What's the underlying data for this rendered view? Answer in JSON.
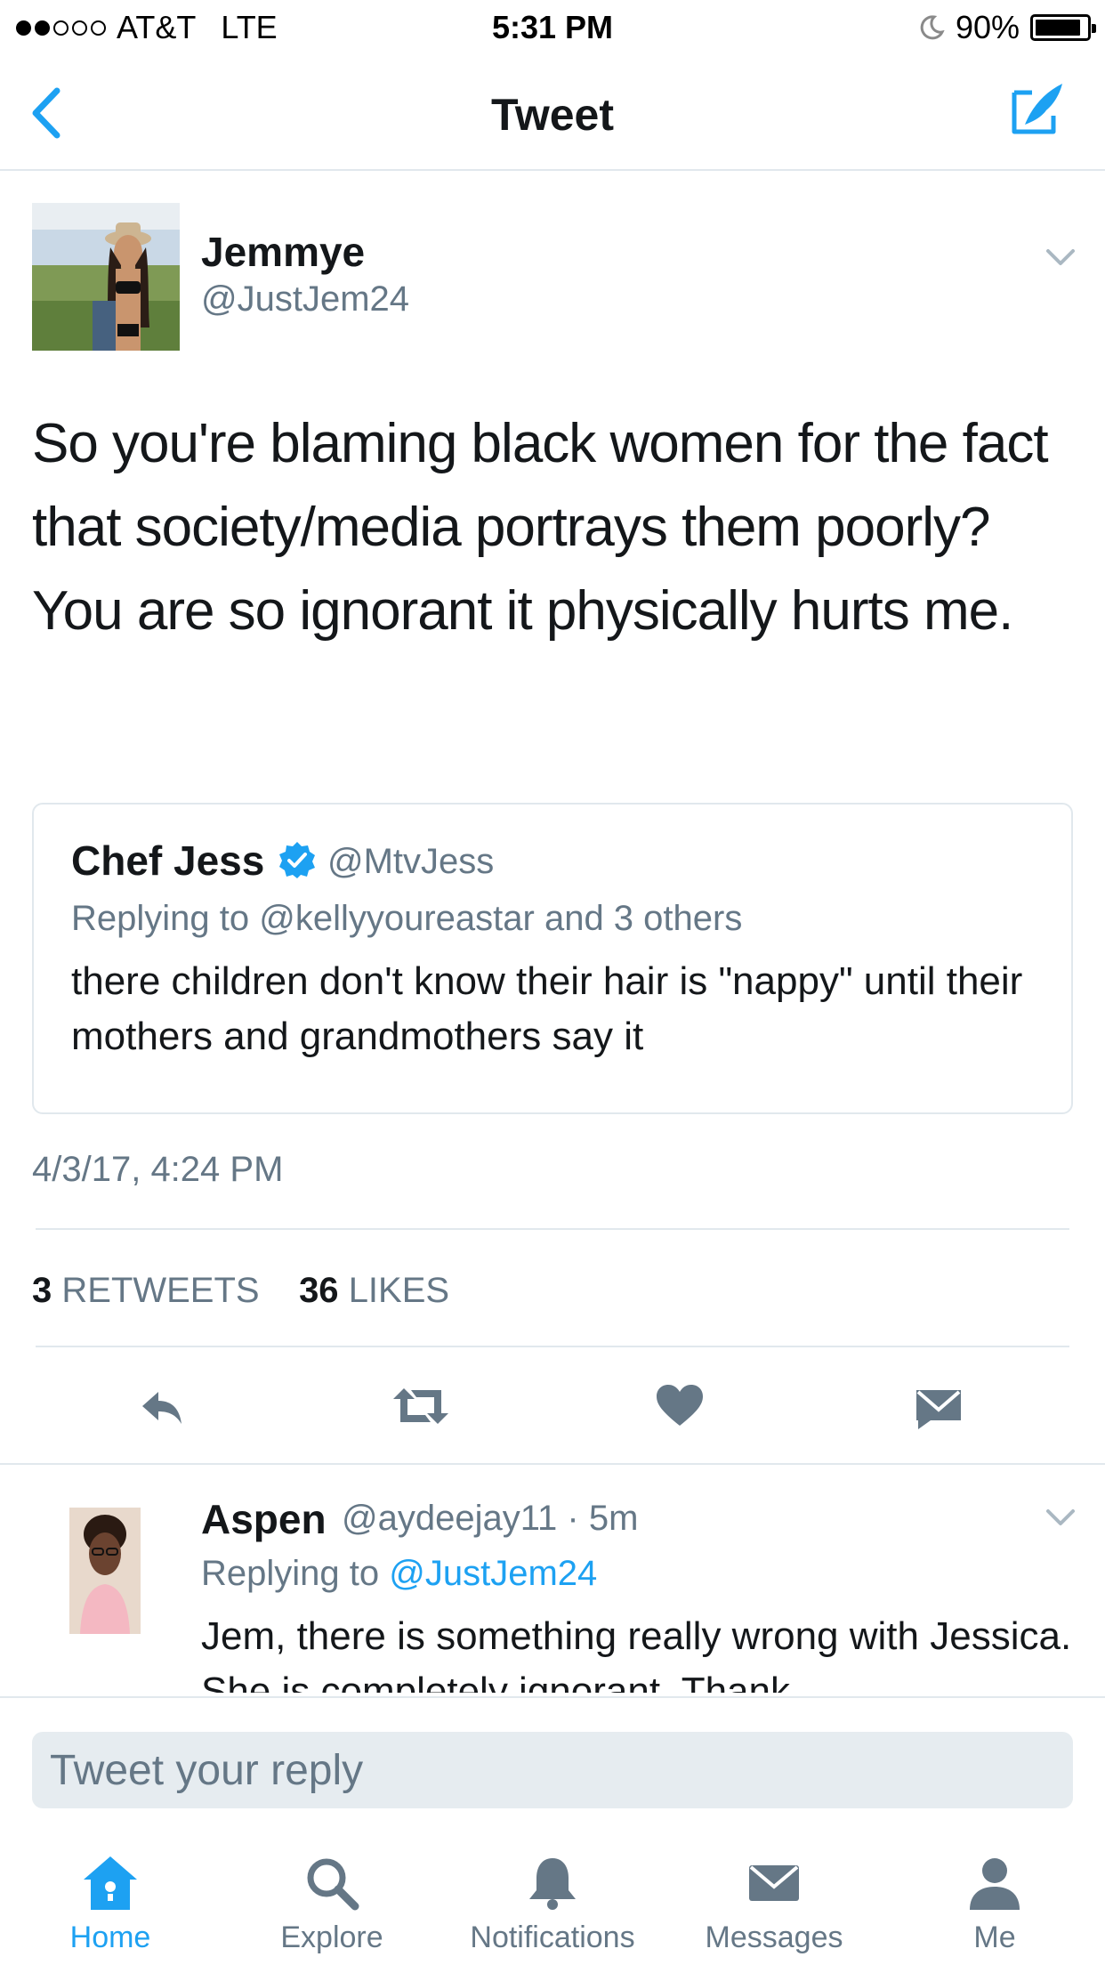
{
  "status_bar": {
    "carrier": "AT&T",
    "network": "LTE",
    "time": "5:31 PM",
    "battery_percent": "90%",
    "battery_level": 0.9,
    "signal_bars": 2
  },
  "nav": {
    "title": "Tweet",
    "back_icon": "chevron-left-icon",
    "compose_icon": "compose-tweet-icon",
    "accent_color": "#1da1f2"
  },
  "tweet": {
    "author_name": "Jemmye",
    "author_handle": "@JustJem24",
    "text": "So you're blaming black women for the fact that society/media portrays them poorly? You are so ignorant it physically hurts me.",
    "timestamp": "4/3/17, 4:24 PM",
    "retweets_count": "3",
    "retweets_label": "RETWEETS",
    "likes_count": "36",
    "likes_label": "LIKES",
    "quoted": {
      "author_name": "Chef Jess",
      "verified": true,
      "author_handle": "@MtvJess",
      "replying_to": "Replying to @kellyyoureastar and 3 others",
      "text": "there children don't know their hair is \"nappy\" until their mothers and grandmothers say it"
    }
  },
  "reply": {
    "author_name": "Aspen",
    "author_handle": "@aydeejay11",
    "separator": "·",
    "age": "5m",
    "replying_prefix": "Replying to",
    "replying_handle": "@JustJem24",
    "text": "Jem, there is something really wrong with Jessica. She is completely ignorant. Thank"
  },
  "composer": {
    "placeholder": "Tweet your reply"
  },
  "tabbar": {
    "home": "Home",
    "explore": "Explore",
    "notifications": "Notifications",
    "messages": "Messages",
    "me": "Me"
  }
}
